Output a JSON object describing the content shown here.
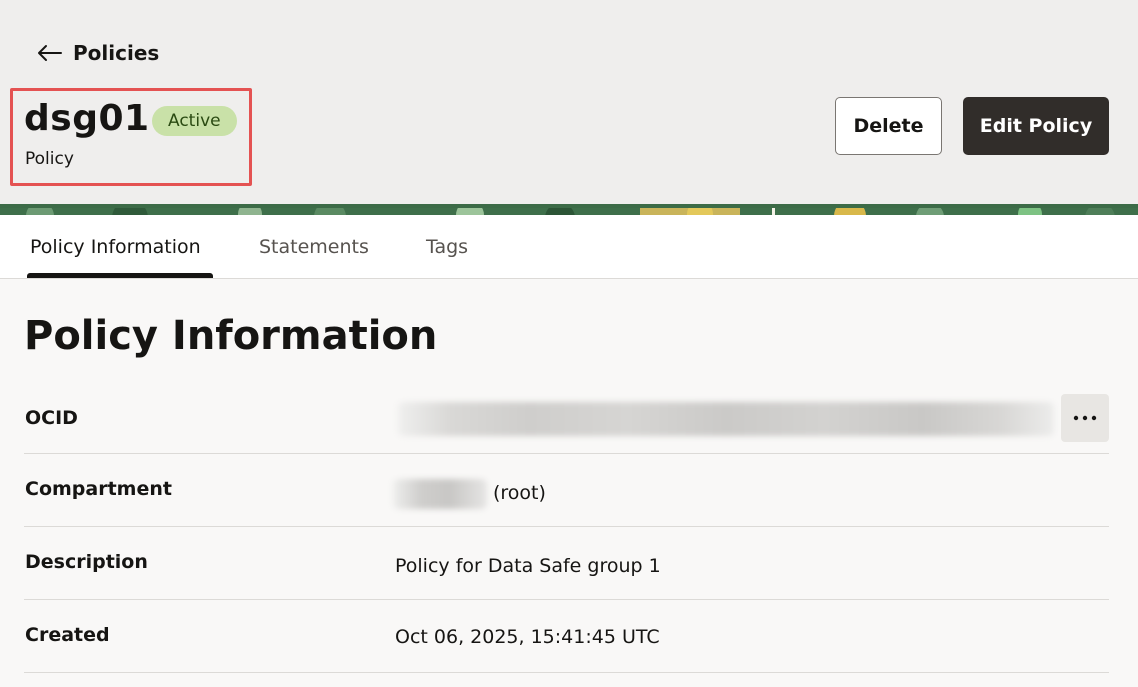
{
  "header": {
    "back_label": "Policies",
    "title": "dsg01",
    "status_badge": "Active",
    "subtitle": "Policy",
    "delete_label": "Delete",
    "edit_label": "Edit Policy"
  },
  "tabs": [
    {
      "label": "Policy Information",
      "active": true
    },
    {
      "label": "Statements",
      "active": false
    },
    {
      "label": "Tags",
      "active": false
    }
  ],
  "section": {
    "title": "Policy Information",
    "rows": [
      {
        "label": "OCID",
        "value": ""
      },
      {
        "label": "Compartment",
        "value": "(root)"
      },
      {
        "label": "Description",
        "value": "Policy for Data Safe group 1"
      },
      {
        "label": "Created",
        "value": "Oct 06, 2025, 15:41:45 UTC"
      }
    ]
  },
  "colors": {
    "accent_dark": "#312d2a",
    "badge_bg": "#c9e1a8",
    "highlight_border": "#e45252"
  },
  "icons": {
    "back": "arrow-left-icon",
    "more": "more-horizontal-icon"
  }
}
